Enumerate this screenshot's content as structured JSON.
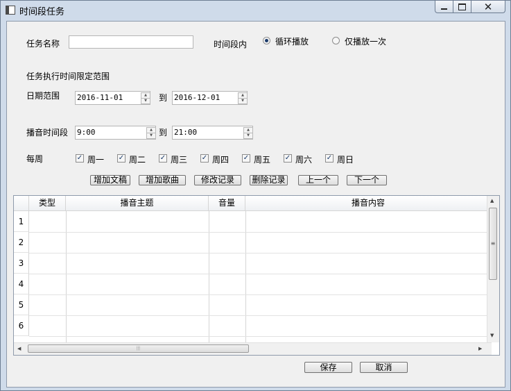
{
  "window": {
    "title": "时间段任务",
    "close_glyph": "✕"
  },
  "form": {
    "task_name_label": "任务名称",
    "task_name_value": "",
    "time_range_label": "时间段内",
    "radio_loop_label": "循环播放",
    "radio_once_label": "仅播放一次",
    "radio_selected": "loop",
    "limit_section_label": "任务执行时间限定范围",
    "date_range_label": "日期范围",
    "date_from": "2016-11-01",
    "date_to": "2016-12-01",
    "to_label": "到",
    "play_time_label": "播音时间段",
    "time_from": "9:00",
    "time_to": "21:00",
    "weekly_label": "每周",
    "weekdays": [
      {
        "label": "周一",
        "checked": true
      },
      {
        "label": "周二",
        "checked": true
      },
      {
        "label": "周三",
        "checked": true
      },
      {
        "label": "周四",
        "checked": true
      },
      {
        "label": "周五",
        "checked": true
      },
      {
        "label": "周六",
        "checked": true
      },
      {
        "label": "周日",
        "checked": true
      }
    ]
  },
  "actions": {
    "add_script": "增加文稿",
    "add_song": "增加歌曲",
    "edit_record": "修改记录",
    "delete_record": "删除记录",
    "prev": "上一个",
    "next": "下一个"
  },
  "table": {
    "columns": [
      "类型",
      "播音主题",
      "音量",
      "播音内容"
    ],
    "row_numbers": [
      "1",
      "2",
      "3",
      "4",
      "5",
      "6"
    ]
  },
  "footer": {
    "save": "保存",
    "cancel": "取消"
  },
  "icons": {
    "spin_up": "▲",
    "spin_down": "▼",
    "check": "✓",
    "scroll_up": "▲",
    "scroll_down": "▼",
    "scroll_left": "◀",
    "scroll_right": "▶",
    "grip_v": "≡",
    "grip_h": "⦙⦙⦙"
  }
}
